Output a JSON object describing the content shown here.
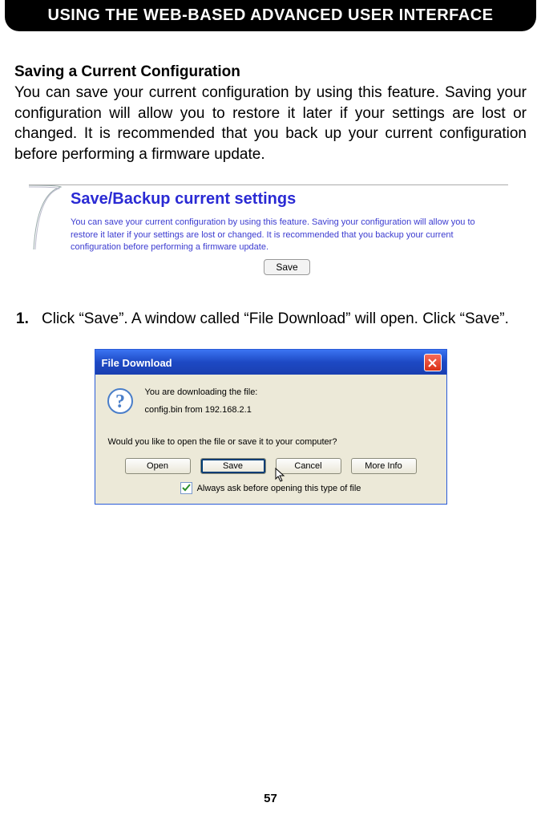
{
  "header": {
    "title": "USING THE WEB-BASED ADVANCED USER INTERFACE"
  },
  "section": {
    "title": "Saving a Current Configuration",
    "body": "You can save your current configuration by using this feature. Saving your configuration will allow you to restore it later if your settings are lost or changed. It is recommended that you back up your current configuration before performing a firmware update."
  },
  "panel": {
    "heading": "Save/Backup current settings",
    "text": "You can save your current configuration by using this feature. Saving your configuration will allow you to restore it later if your settings are lost or changed. It is recommended that you backup your current configuration before performing a firmware update.",
    "save": "Save"
  },
  "step": {
    "num": "1.",
    "text": "Click “Save”. A window called “File Download” will open. Click “Save”."
  },
  "dialog": {
    "title": "File Download",
    "line1": "You are downloading the file:",
    "line2": "config.bin from 192.168.2.1",
    "question": "Would you like to open the file or save it to your computer?",
    "buttons": {
      "open": "Open",
      "save": "Save",
      "cancel": "Cancel",
      "more": "More Info"
    },
    "checkbox": "Always ask before opening this type of file"
  },
  "page": "57"
}
